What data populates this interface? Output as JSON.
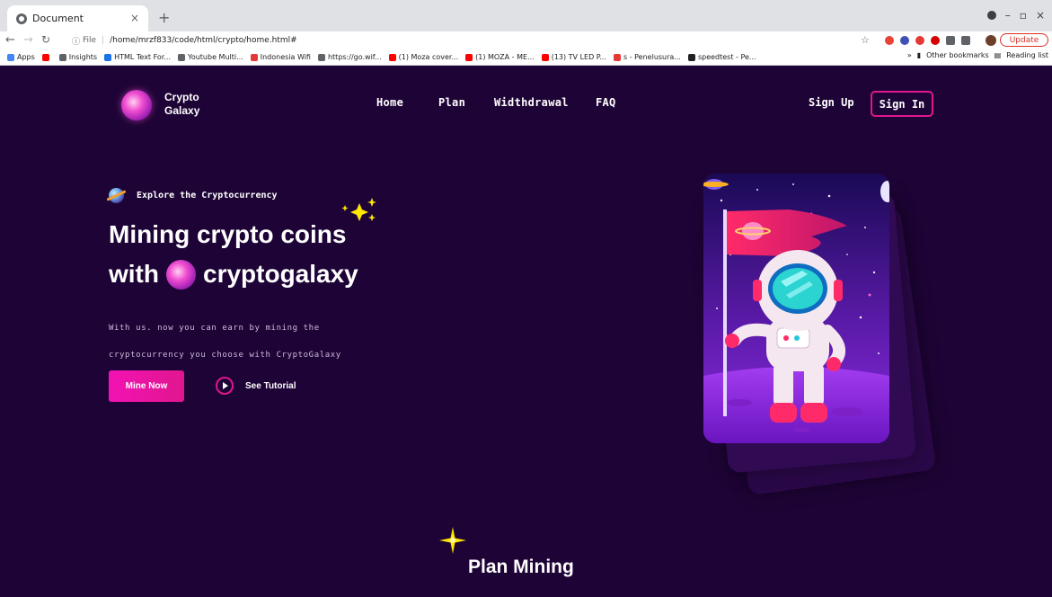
{
  "browser": {
    "tab_title": "Document",
    "tab_close": "×",
    "new_tab": "+",
    "url_prefix": "File",
    "url": "/home/mrzf833/code/html/crypto/home.html#",
    "update_label": "Update",
    "bookmarks": [
      {
        "label": "Apps",
        "color": "#4285f4"
      },
      {
        "label": "",
        "color": "#ff0000"
      },
      {
        "label": "Insights",
        "color": "#5f6368"
      },
      {
        "label": "HTML Text For...",
        "color": "#1a73e8"
      },
      {
        "label": "Youtube Multi...",
        "color": "#5f6368"
      },
      {
        "label": "Indonesia Wifi",
        "color": "#e53935"
      },
      {
        "label": "https://go.wif...",
        "color": "#5f6368"
      },
      {
        "label": "(1) Moza cover...",
        "color": "#ff0000"
      },
      {
        "label": "(1) MOZA - ME...",
        "color": "#ff0000"
      },
      {
        "label": "(13) TV LED P...",
        "color": "#ff0000"
      },
      {
        "label": "s - Penelusura...",
        "color": "#e53935"
      },
      {
        "label": "speedtest - Pe...",
        "color": "#202124"
      }
    ],
    "other_bookmarks": "Other bookmarks",
    "reading_list": "Reading list"
  },
  "site": {
    "brand_line1": "Crypto",
    "brand_line2": "Galaxy",
    "nav": {
      "home": "Home",
      "plan": "Plan",
      "withdrawal": "Widthdrawal",
      "faq": "FAQ"
    },
    "sign_up": "Sign Up",
    "sign_in": "Sign In"
  },
  "hero": {
    "eyebrow": "Explore the Cryptocurrency",
    "title_line1": "Mining crypto coins",
    "title_line2_prefix": "with",
    "title_line2_suffix": "cryptogalaxy",
    "desc_line1": "With us. now you can earn by mining the",
    "desc_line2": "cryptocurrency you choose with CryptoGalaxy",
    "cta_primary": "Mine Now",
    "cta_secondary": "See Tutorial"
  },
  "plans": {
    "title": "Plan Mining"
  },
  "colors": {
    "background": "#1e0436",
    "accent": "#e0168e",
    "accent_button": "#f312b4"
  }
}
